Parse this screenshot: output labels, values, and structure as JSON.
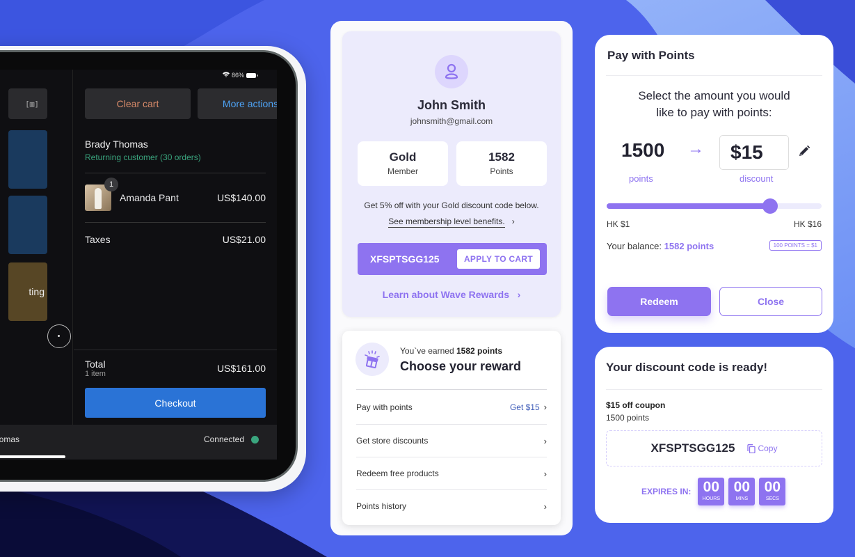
{
  "pos": {
    "status": {
      "battery_text": "86%"
    },
    "scan_icon_glyph": "[▥]",
    "tile_partial_label": "ting",
    "clear_cart_label": "Clear cart",
    "more_actions_label": "More actions",
    "customer": {
      "name": "Brady Thomas",
      "subtitle": "Returning customer (30 orders)"
    },
    "line_items": [
      {
        "quantity": "1",
        "name": "Amanda Pant",
        "price": "US$140.00"
      }
    ],
    "taxes": {
      "label": "Taxes",
      "amount": "US$21.00"
    },
    "total": {
      "label": "Total",
      "count": "1 item",
      "amount": "US$161.00"
    },
    "checkout_label": "Checkout",
    "footer": {
      "user_partial": "homas",
      "connection": "Connected"
    },
    "colors": {
      "checkout": "#2a73d6",
      "connected": "#3aa57e",
      "clear": "#d98b6a",
      "more": "#4ea3f5"
    }
  },
  "profile": {
    "name": "John Smith",
    "email": "johnsmith@gmail.com",
    "tier": {
      "value": "Gold",
      "label": "Member"
    },
    "points": {
      "value": "1582",
      "label": "Points"
    },
    "benefit_text": "Get 5% off with your Gold discount code below.",
    "benefit_link": "See membership level benefits.",
    "discount_code": "XFSPTSGG125",
    "apply_label": "APPLY TO CART",
    "learn_link": "Learn about Wave Rewards"
  },
  "rewards": {
    "earned_prefix": "You`ve earned",
    "earned_points": "1582 points",
    "title": "Choose your reward",
    "items": [
      {
        "label": "Pay with points",
        "value": "Get $15"
      },
      {
        "label": "Get store discounts",
        "value": ""
      },
      {
        "label": "Redeem free products",
        "value": ""
      },
      {
        "label": "Points history",
        "value": ""
      }
    ]
  },
  "pay_points": {
    "title": "Pay with Points",
    "prompt_line1": "Select the amount you would",
    "prompt_line2": "like to pay with points:",
    "points_value": "1500",
    "points_label": "points",
    "discount_value": "$15",
    "discount_label": "discount",
    "slider": {
      "min_label": "HK $1",
      "max_label": "HK $16",
      "fraction": 0.76
    },
    "balance_label": "Your balance:",
    "balance_value": "1582 points",
    "rate": "100 POINTS = $1",
    "redeem_label": "Redeem",
    "close_label": "Close",
    "accent": "#8e73f0"
  },
  "code_ready": {
    "title": "Your discount code is ready!",
    "coupon_title": "$15 off coupon",
    "coupon_points": "1500 points",
    "code": "XFSPTSGG125",
    "copy_label": "Copy",
    "expires_label": "EXPIRES IN:",
    "countdown": [
      {
        "value": "00",
        "unit": "HOURS"
      },
      {
        "value": "00",
        "unit": "MINS"
      },
      {
        "value": "00",
        "unit": "SECS"
      }
    ]
  }
}
